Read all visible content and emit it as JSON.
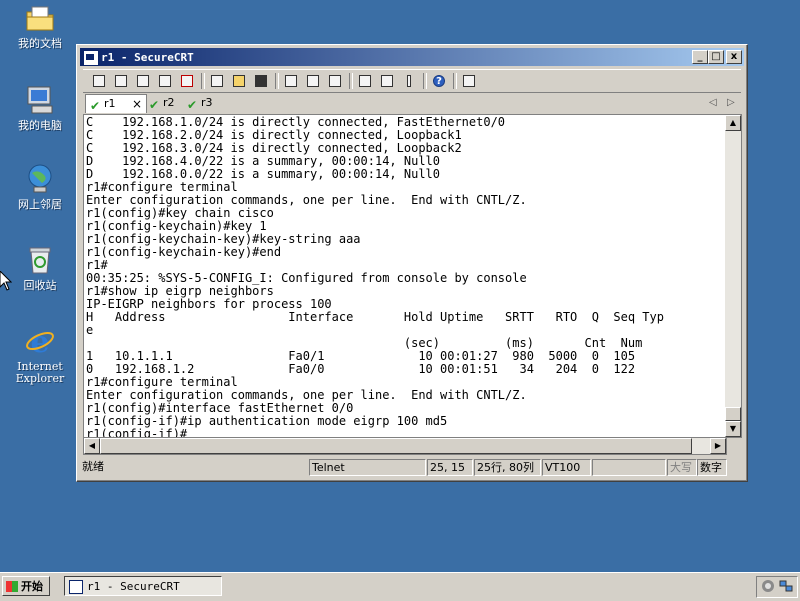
{
  "desktop": {
    "icons": [
      {
        "label": "我的文档",
        "icon": "my-documents-icon"
      },
      {
        "label": "我的电脑",
        "icon": "my-computer-icon"
      },
      {
        "label": "网上邻居",
        "icon": "network-places-icon"
      },
      {
        "label": "回收站",
        "icon": "recycle-bin-icon"
      },
      {
        "label": "Internet Explorer",
        "icon": "internet-explorer-icon"
      }
    ]
  },
  "window": {
    "title": "r1 - SecureCRT",
    "controls": {
      "minimize": "_",
      "maximize": "□",
      "close": "x"
    }
  },
  "tabs": [
    {
      "label": "r1",
      "active": true,
      "close": "×"
    },
    {
      "label": "r2",
      "active": false
    },
    {
      "label": "r3",
      "active": false
    }
  ],
  "tab_nav": {
    "prev": "◁",
    "next": "▷"
  },
  "terminal": {
    "lines": [
      "C    192.168.1.0/24 is directly connected, FastEthernet0/0",
      "C    192.168.2.0/24 is directly connected, Loopback1",
      "C    192.168.3.0/24 is directly connected, Loopback2",
      "D    192.168.4.0/22 is a summary, 00:00:14, Null0",
      "D    192.168.0.0/22 is a summary, 00:00:14, Null0",
      "r1#configure terminal",
      "Enter configuration commands, one per line.  End with CNTL/Z.",
      "r1(config)#key chain cisco",
      "r1(config-keychain)#key 1",
      "r1(config-keychain-key)#key-string aaa",
      "r1(config-keychain-key)#end",
      "r1#",
      "00:35:25: %SYS-5-CONFIG_I: Configured from console by console",
      "r1#show ip eigrp neighbors",
      "IP-EIGRP neighbors for process 100",
      "H   Address                 Interface       Hold Uptime   SRTT   RTO  Q  Seq Typ",
      "e",
      "                                            (sec)         (ms)       Cnt  Num",
      "1   10.1.1.1                Fa0/1             10 00:01:27  980  5000  0  105",
      "0   192.168.1.2             Fa0/0             10 00:01:51   34   204  0  122",
      "r1#configure terminal",
      "Enter configuration commands, one per line.  End with CNTL/Z.",
      "r1(config)#interface fastEthernet 0/0",
      "r1(config-if)#ip authentication mode eigrp 100 md5",
      "r1(config-if)#"
    ]
  },
  "statusbar": {
    "ready": "就绪",
    "protocol": "Telnet",
    "cursor": "25, 15",
    "size": "25行, 80列",
    "emulation": "VT100",
    "caps": "大写",
    "num": "数字"
  },
  "taskbar": {
    "start": "开始",
    "task": "r1 - SecureCRT"
  },
  "colors": {
    "desktop": "#3a6ea5",
    "title_active": "#0a246a",
    "title_gradient_end": "#a6caf0",
    "chrome": "#d4d0c8"
  }
}
